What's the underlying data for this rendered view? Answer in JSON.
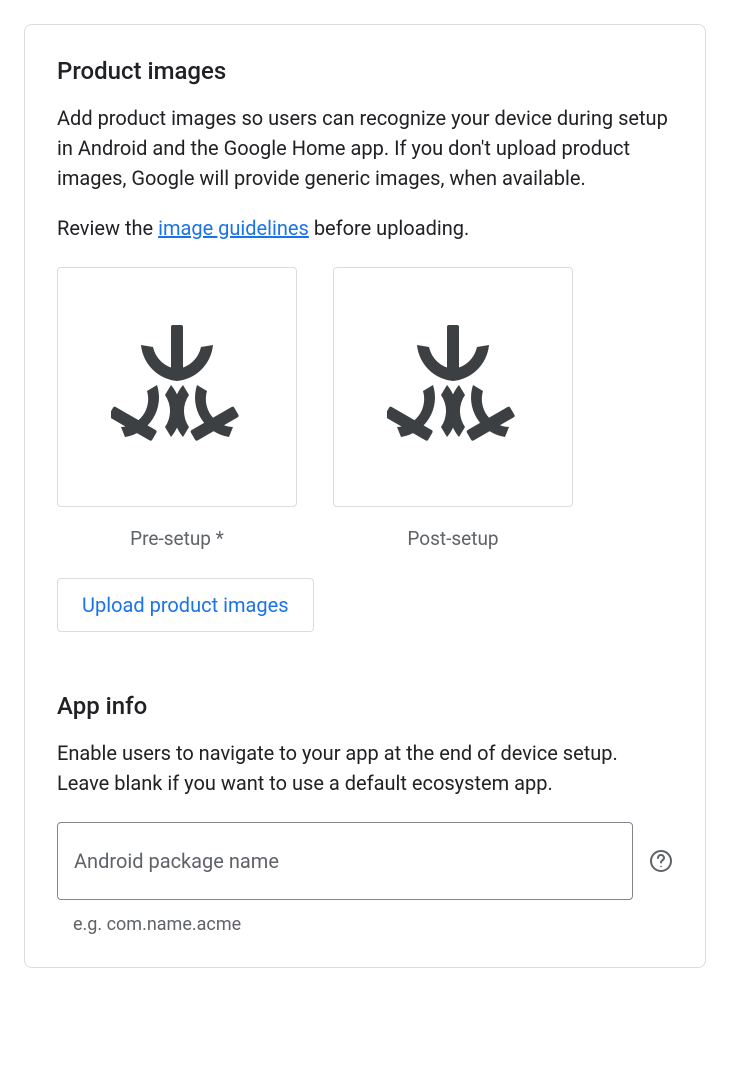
{
  "productImages": {
    "title": "Product images",
    "description": "Add product images so users can recognize your device during setup in Android and the Google Home app. If you don't upload product images, Google will provide generic images, when available.",
    "reviewPrefix": "Review the ",
    "guidelinesLink": "image guidelines",
    "reviewSuffix": " before uploading.",
    "slots": {
      "preSetup": "Pre-setup *",
      "postSetup": "Post-setup"
    },
    "uploadButton": "Upload product images"
  },
  "appInfo": {
    "title": "App info",
    "description": "Enable users to navigate to your app at the end of device setup. Leave blank if you want to use a default ecosystem app.",
    "packageInput": {
      "placeholder": "Android package name",
      "value": "",
      "hint": "e.g. com.name.acme"
    }
  }
}
